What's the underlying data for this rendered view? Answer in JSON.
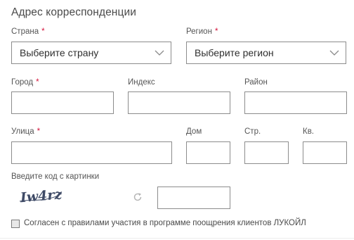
{
  "section": {
    "title": "Адрес корреспонденции",
    "required_mark": "*"
  },
  "fields": {
    "country": {
      "label": "Страна",
      "value": "Выберите страну"
    },
    "region": {
      "label": "Регион",
      "value": "Выберите регион"
    },
    "city": {
      "label": "Город",
      "value": ""
    },
    "index": {
      "label": "Индекс",
      "value": ""
    },
    "district": {
      "label": "Район",
      "value": ""
    },
    "street": {
      "label": "Улица",
      "value": ""
    },
    "house": {
      "label": "Дом",
      "value": ""
    },
    "building": {
      "label": "Стр.",
      "value": ""
    },
    "apartment": {
      "label": "Кв.",
      "value": ""
    }
  },
  "captcha": {
    "label": "Введите код с картинки",
    "image_text": "Iw4rz",
    "value": ""
  },
  "consent": {
    "checked": false,
    "text": "Согласен с правилами участия в программе поощрения клиентов ЛУКОЙЛ"
  },
  "icons": {
    "dropdown": "chevron-down-icon",
    "refresh": "refresh-icon"
  },
  "colors": {
    "required": "#d4143c",
    "border": "#8c8c8c"
  }
}
